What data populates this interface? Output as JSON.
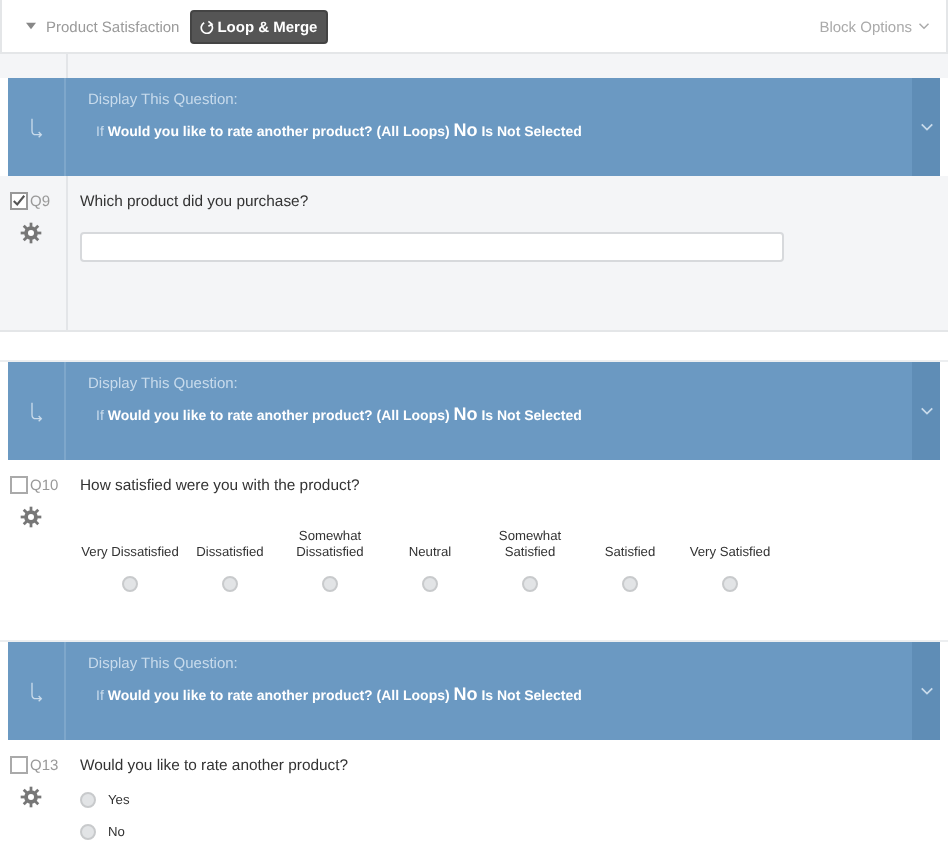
{
  "block_header": {
    "block_title": "Product Satisfaction",
    "loop_button": "Loop & Merge",
    "options_menu": "Block Options"
  },
  "questions": [
    {
      "kind": "text_entry",
      "logic": {
        "heading": "Display This Question:",
        "prefix": "If",
        "question": "Would you like to rate another product? (All Loops)",
        "choice": "No",
        "operator": "Is Not Selected"
      },
      "number": "Q9",
      "checked": true,
      "text": "Which product did you purchase?"
    },
    {
      "kind": "likert",
      "logic": {
        "heading": "Display This Question:",
        "prefix": "If",
        "question": "Would you like to rate another product? (All Loops)",
        "choice": "No",
        "operator": "Is Not Selected"
      },
      "number": "Q10",
      "checked": false,
      "text": "How satisfied were you with the product?",
      "choices": [
        {
          "label": "Very Dissatisfied",
          "selected": false
        },
        {
          "label": "Dissatisfied",
          "selected": false
        },
        {
          "label": "Somewhat Dissatisfied",
          "selected": false
        },
        {
          "label": "Neutral",
          "selected": false
        },
        {
          "label": "Somewhat Satisfied",
          "selected": false
        },
        {
          "label": "Satisfied",
          "selected": false
        },
        {
          "label": "Very Satisfied",
          "selected": false
        }
      ]
    },
    {
      "kind": "multiple_choice",
      "logic": {
        "heading": "Display This Question:",
        "prefix": "If",
        "question": "Would you like to rate another product? (All Loops)",
        "choice": "No",
        "operator": "Is Not Selected"
      },
      "number": "Q13",
      "checked": false,
      "text": "Would you like to rate another product?",
      "choices": [
        {
          "label": "Yes",
          "selected": false
        },
        {
          "label": "No",
          "selected": false
        }
      ]
    }
  ]
}
